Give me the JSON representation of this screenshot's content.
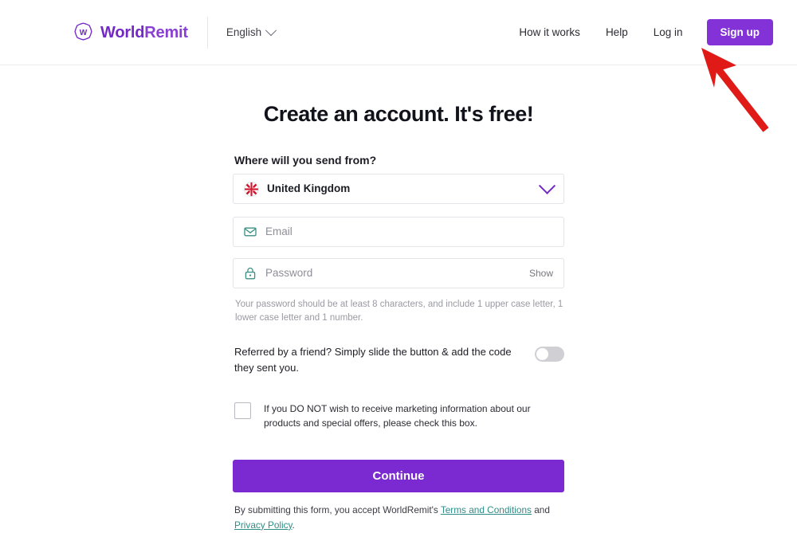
{
  "header": {
    "brand": {
      "icon": "worldremit-logo-icon",
      "name_part1": "World",
      "name_part2": "Remit"
    },
    "language": {
      "label": "English",
      "chevron_icon": "chevron-down-icon"
    },
    "nav": [
      {
        "label": "How it works",
        "name": "how-it-works"
      },
      {
        "label": "Help",
        "name": "help"
      },
      {
        "label": "Log in",
        "name": "log-in"
      }
    ],
    "signup_label": "Sign up"
  },
  "annotation": {
    "arrow_icon": "red-arrow-pointing-to-signup",
    "color": "#e01b17"
  },
  "main": {
    "title": "Create an account. It's free!",
    "country": {
      "label": "Where will you send from?",
      "flag_icon": "united-kingdom-flag-icon",
      "value": "United Kingdom",
      "chevron_icon": "chevron-down-icon"
    },
    "email": {
      "icon": "envelope-icon",
      "placeholder": "Email",
      "value": ""
    },
    "password": {
      "icon": "lock-icon",
      "placeholder": "Password",
      "value": "",
      "show_label": "Show",
      "helper": "Your password should be at least 8 characters, and include 1 upper case letter, 1 lower case letter and 1 number."
    },
    "referral": {
      "text": "Referred by a friend? Simply slide the button & add the code they sent you.",
      "toggle_state": "off"
    },
    "marketing_optout": {
      "text": "If you DO NOT wish to receive marketing information about our products and special offers, please check this box.",
      "checked": false
    },
    "continue_label": "Continue",
    "legal": {
      "part1": "By submitting this form, you accept WorldRemit's ",
      "terms_link": "Terms and Conditions",
      "part2": " and ",
      "privacy_link": "Privacy Policy",
      "part3": "."
    }
  },
  "colors": {
    "brand_purple": "#7229c6",
    "button_purple": "#7a2ad0",
    "link_teal": "#2f8d87",
    "icon_teal": "#3a8f84",
    "annotation_red": "#e01b17"
  }
}
